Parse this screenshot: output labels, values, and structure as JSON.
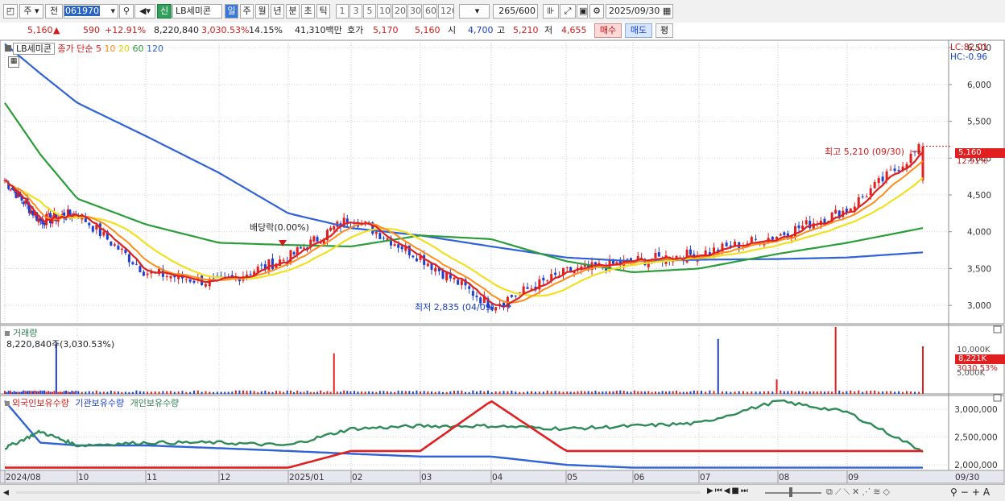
{
  "toolbar": {
    "market": "주",
    "prev": "전",
    "code": "061970",
    "badge": "신",
    "name": "LB세미콘",
    "periods": [
      "일",
      "주",
      "월",
      "년",
      "분",
      "초",
      "틱"
    ],
    "active_period": "일",
    "intervals": [
      "1",
      "3",
      "5",
      "10",
      "20",
      "30",
      "60",
      "120"
    ],
    "count": "265",
    "count_total": "/600",
    "date": "2025/09/30"
  },
  "quote": {
    "price": "5,160",
    "arrow": "▲",
    "change": "590",
    "change_pct": "+12.91%",
    "volume": "8,220,840",
    "volume_pct": "3,030.53%",
    "turnover_pct": "14.15%",
    "amount": "41,310백만",
    "bid_label": "호가",
    "bid": "5,170",
    "ask": "5,160",
    "open_label": "시",
    "open": "4,700",
    "high_label": "고",
    "high": "5,210",
    "low_label": "저",
    "low": "4,655",
    "buy": "매수",
    "sell": "매도",
    "even": "평"
  },
  "price_panel": {
    "title": "LB세미콘",
    "ma_label": "종가 단순",
    "ma_periods": [
      "5",
      "10",
      "20",
      "60",
      "120"
    ],
    "lc": "LC:82.01",
    "hc": "HC:-0.96",
    "high_annotation": "최고 5,210 (09/30)",
    "low_annotation": "최저 2,835 (04/09)",
    "dividend_annotation": "배당락(0.00%)",
    "last_price_tag": "5,160",
    "last_pct_tag": "12.91%",
    "y_ticks": [
      "6,500",
      "6,000",
      "5,500",
      "5,000",
      "4,500",
      "4,000",
      "3,500",
      "3,000"
    ]
  },
  "volume_panel": {
    "title": "거래량",
    "value": "8,220,840주(3,030.53%)",
    "tick": "10,000K",
    "tick2": "5,000K",
    "tag": "8,221K",
    "tag_pct": "3030.53%"
  },
  "holdings_panel": {
    "series": [
      "외국인보유수량",
      "기관보유수량",
      "개인보유수량"
    ],
    "y_ticks": [
      "3,000,000",
      "2,500,000",
      "2,000,000"
    ]
  },
  "x_axis": {
    "labels": [
      "2024/08",
      "10",
      "11",
      "12",
      "2025/01",
      "02",
      "03",
      "04",
      "05",
      "06",
      "07",
      "08",
      "09"
    ],
    "right_label": "09/30"
  },
  "colors": {
    "up": "#e02020",
    "down": "#1f3fd0",
    "ma5": "#e02020",
    "ma10": "#ff8c1a",
    "ma20": "#f0e020",
    "ma60": "#2a9d3a",
    "ma120": "#2f62d6",
    "foreign": "#e02020",
    "institution": "#2f62d6",
    "individual": "#2e8b57"
  },
  "chart_data": {
    "type": "line",
    "title": "LB세미콘",
    "x": [
      "2024/08",
      "2024/09",
      "2024/10",
      "2024/11",
      "2024/12",
      "2025/01",
      "2025/02",
      "2025/03",
      "2025/04",
      "2025/05",
      "2025/06",
      "2025/07",
      "2025/08",
      "2025/09",
      "09/30"
    ],
    "series": [
      {
        "name": "종가 (close)",
        "values": [
          4700,
          4150,
          4250,
          3450,
          3300,
          3650,
          4200,
          3650,
          3000,
          3450,
          3600,
          3700,
          3950,
          4300,
          5160
        ]
      },
      {
        "name": "120",
        "values": [
          6550,
          6150,
          5750,
          5300,
          4800,
          4250,
          4050,
          3950,
          3800,
          3650,
          3600,
          3620,
          3630,
          3650,
          3720
        ]
      },
      {
        "name": "60",
        "values": [
          5750,
          5050,
          4450,
          4100,
          3850,
          3820,
          3800,
          3950,
          3900,
          3600,
          3450,
          3500,
          3700,
          3850,
          4050
        ]
      },
      {
        "name": "외국인보유수량",
        "values": [
          1950000,
          1950000,
          1950000,
          1950000,
          1950000,
          1950000,
          2250000,
          2250000,
          3150000,
          2250000,
          2250000,
          2250000,
          2250000,
          2250000,
          2250000
        ]
      },
      {
        "name": "기관보유수량",
        "values": [
          3150000,
          2400000,
          2350000,
          2350000,
          2300000,
          2250000,
          2200000,
          2150000,
          2150000,
          2000000,
          1950000,
          1950000,
          1950000,
          1950000,
          1950000
        ]
      },
      {
        "name": "개인보유수량",
        "values": [
          2300000,
          2600000,
          2350000,
          2400000,
          2400000,
          2350000,
          2650000,
          2700000,
          2700000,
          2650000,
          2700000,
          2750000,
          3150000,
          2950000,
          2250000
        ]
      }
    ],
    "annotations": [
      "최고 5,210 (09/30)",
      "최저 2,835 (04/09)",
      "배당락(0.00%)"
    ],
    "ylim": [
      2800,
      6600
    ],
    "grid": true
  }
}
